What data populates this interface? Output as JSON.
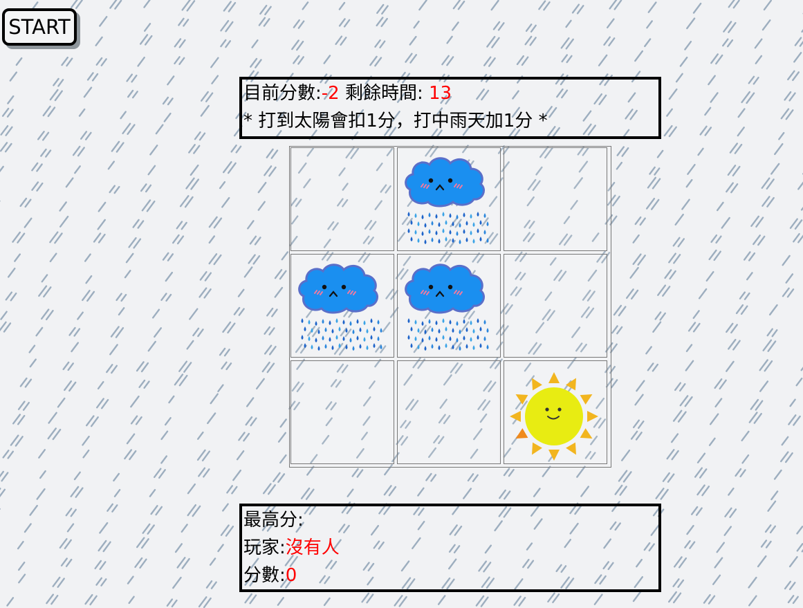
{
  "start_button": {
    "label": "START"
  },
  "score_panel": {
    "score_label": "目前分數:",
    "score_value": "-2",
    "time_label": " 剩餘時間: ",
    "time_value": "13",
    "rule_text": "* 打到太陽會扣1分，打中雨天加1分 *"
  },
  "grid": {
    "rows": 3,
    "cols": 3,
    "cells": [
      "empty",
      "rain-cloud",
      "empty",
      "rain-cloud",
      "rain-cloud",
      "empty",
      "empty",
      "empty",
      "sun"
    ]
  },
  "high_score_panel": {
    "title": "最高分:",
    "player_label": "玩家:",
    "player_value": "沒有人",
    "score_label": "分數:",
    "score_value": "0"
  },
  "colors": {
    "background": "#f1f2f4",
    "rain_streak": "#8ea2b5",
    "highlight_red": "#ff0000",
    "cloud_blue": "#1a8ff0",
    "sun_yellow": "#e8ec12",
    "sun_ray": "#f2b51f"
  }
}
